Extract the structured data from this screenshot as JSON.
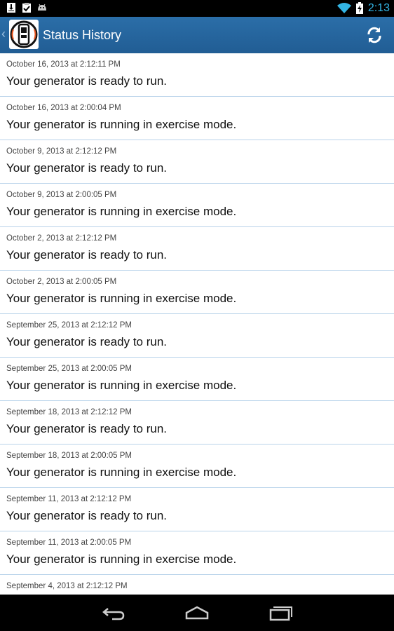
{
  "status_bar": {
    "time": "2:13",
    "icons": [
      "download-icon",
      "clipboard-check-icon",
      "android-icon",
      "wifi-icon",
      "battery-charging-icon"
    ]
  },
  "action_bar": {
    "title": "Status History",
    "up_icon": "chevron-left-icon",
    "logo_icon": "generator-logo-icon",
    "refresh_icon": "refresh-icon"
  },
  "list": {
    "items": [
      {
        "date": "October 16, 2013 at 2:12:11 PM",
        "message": "Your generator is ready to run."
      },
      {
        "date": "October 16, 2013 at 2:00:04 PM",
        "message": "Your generator is running in exercise mode."
      },
      {
        "date": "October 9, 2013 at 2:12:12 PM",
        "message": "Your generator is ready to run."
      },
      {
        "date": "October 9, 2013 at 2:00:05 PM",
        "message": "Your generator is running in exercise mode."
      },
      {
        "date": "October 2, 2013 at 2:12:12 PM",
        "message": "Your generator is ready to run."
      },
      {
        "date": "October 2, 2013 at 2:00:05 PM",
        "message": "Your generator is running in exercise mode."
      },
      {
        "date": "September 25, 2013 at 2:12:12 PM",
        "message": "Your generator is ready to run."
      },
      {
        "date": "September 25, 2013 at 2:00:05 PM",
        "message": "Your generator is running in exercise mode."
      },
      {
        "date": "September 18, 2013 at 2:12:12 PM",
        "message": "Your generator is ready to run."
      },
      {
        "date": "September 18, 2013 at 2:00:05 PM",
        "message": "Your generator is running in exercise mode."
      },
      {
        "date": "September 11, 2013 at 2:12:12 PM",
        "message": "Your generator is ready to run."
      },
      {
        "date": "September 11, 2013 at 2:00:05 PM",
        "message": "Your generator is running in exercise mode."
      },
      {
        "date": "September 4, 2013 at 2:12:12 PM",
        "message": ""
      }
    ]
  },
  "nav_bar": {
    "icons": [
      "back-icon",
      "home-icon",
      "recent-apps-icon"
    ]
  },
  "colors": {
    "action_bar": "#215d94",
    "divider": "#b9d3ea",
    "clock": "#33b5e5"
  }
}
